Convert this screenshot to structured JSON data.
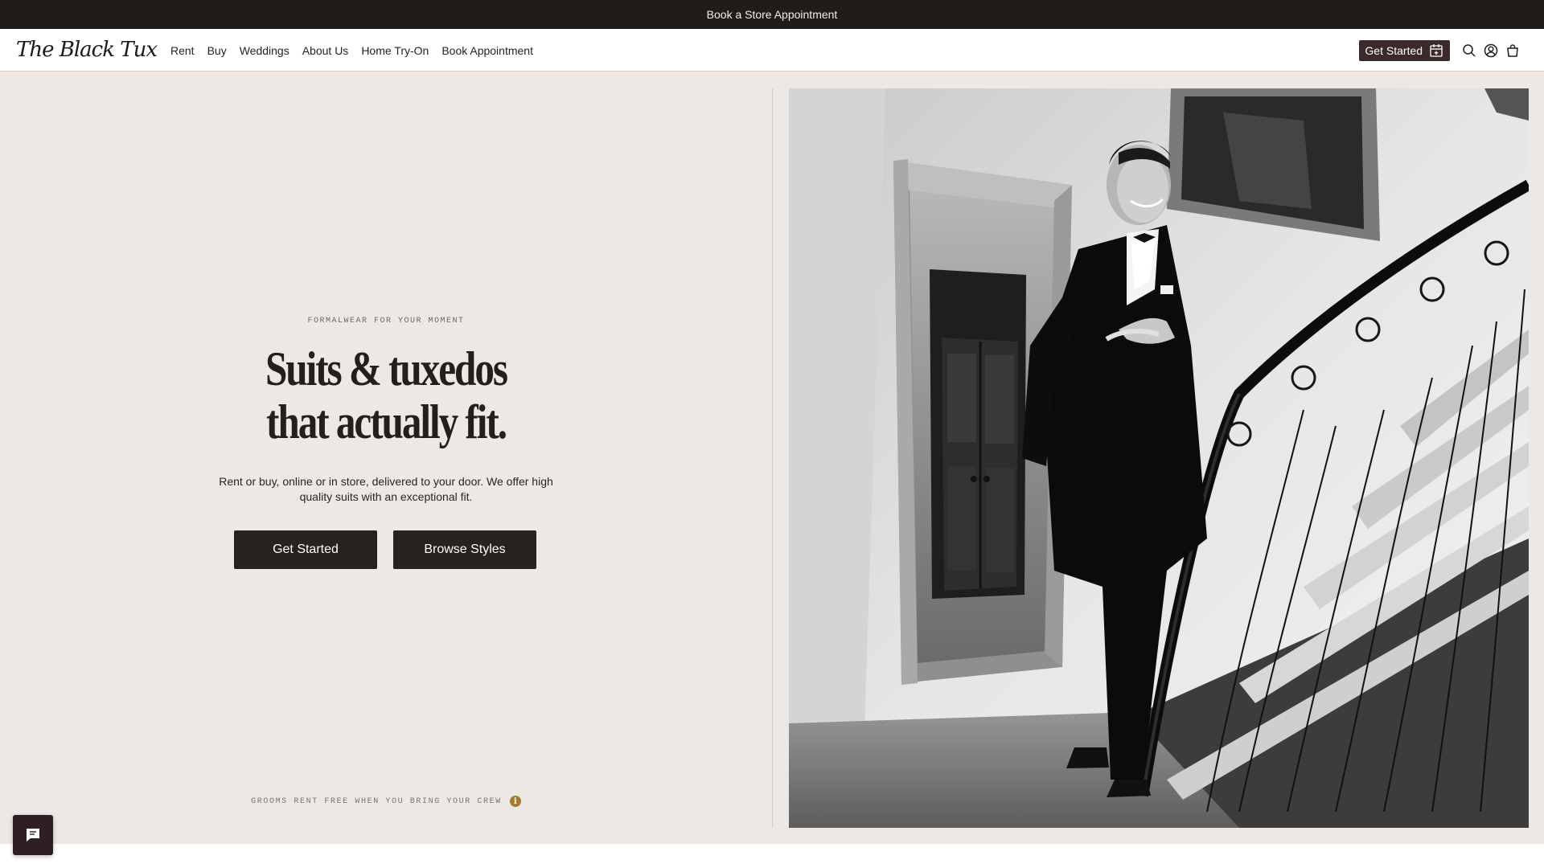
{
  "announcement": {
    "label": "Book a Store Appointment"
  },
  "header": {
    "logo_text": "The Black Tux",
    "menu": [
      {
        "label": "Rent"
      },
      {
        "label": "Buy"
      },
      {
        "label": "Weddings"
      },
      {
        "label": "About Us"
      },
      {
        "label": "Home Try-On"
      },
      {
        "label": "Book Appointment"
      }
    ],
    "cta_label": "Get Started",
    "icons": [
      "calendar-plus-icon",
      "search-icon",
      "account-icon",
      "bag-icon"
    ]
  },
  "hero": {
    "eyebrow": "FORMALWEAR FOR YOUR MOMENT",
    "headline_line1": "Suits & tuxedos",
    "headline_line2": "that actually fit.",
    "lede": "Rent or buy, online or in store, delivered to your door. We offer high quality suits with an exceptional fit.",
    "primary_cta": "Get Started",
    "secondary_cta": "Browse Styles",
    "promo": "GROOMS RENT FREE WHEN YOU BRING YOUR CREW",
    "promo_icon": "info-icon"
  },
  "chat": {
    "icon": "chat-icon"
  },
  "colors": {
    "announcement_bg": "#1f1c1a",
    "page_bg": "#ede8e3",
    "nav_cta_bg": "#3b2a2a",
    "button_bg": "#252220",
    "info_accent": "#a47d2a",
    "chat_bg": "#2f1f24"
  }
}
